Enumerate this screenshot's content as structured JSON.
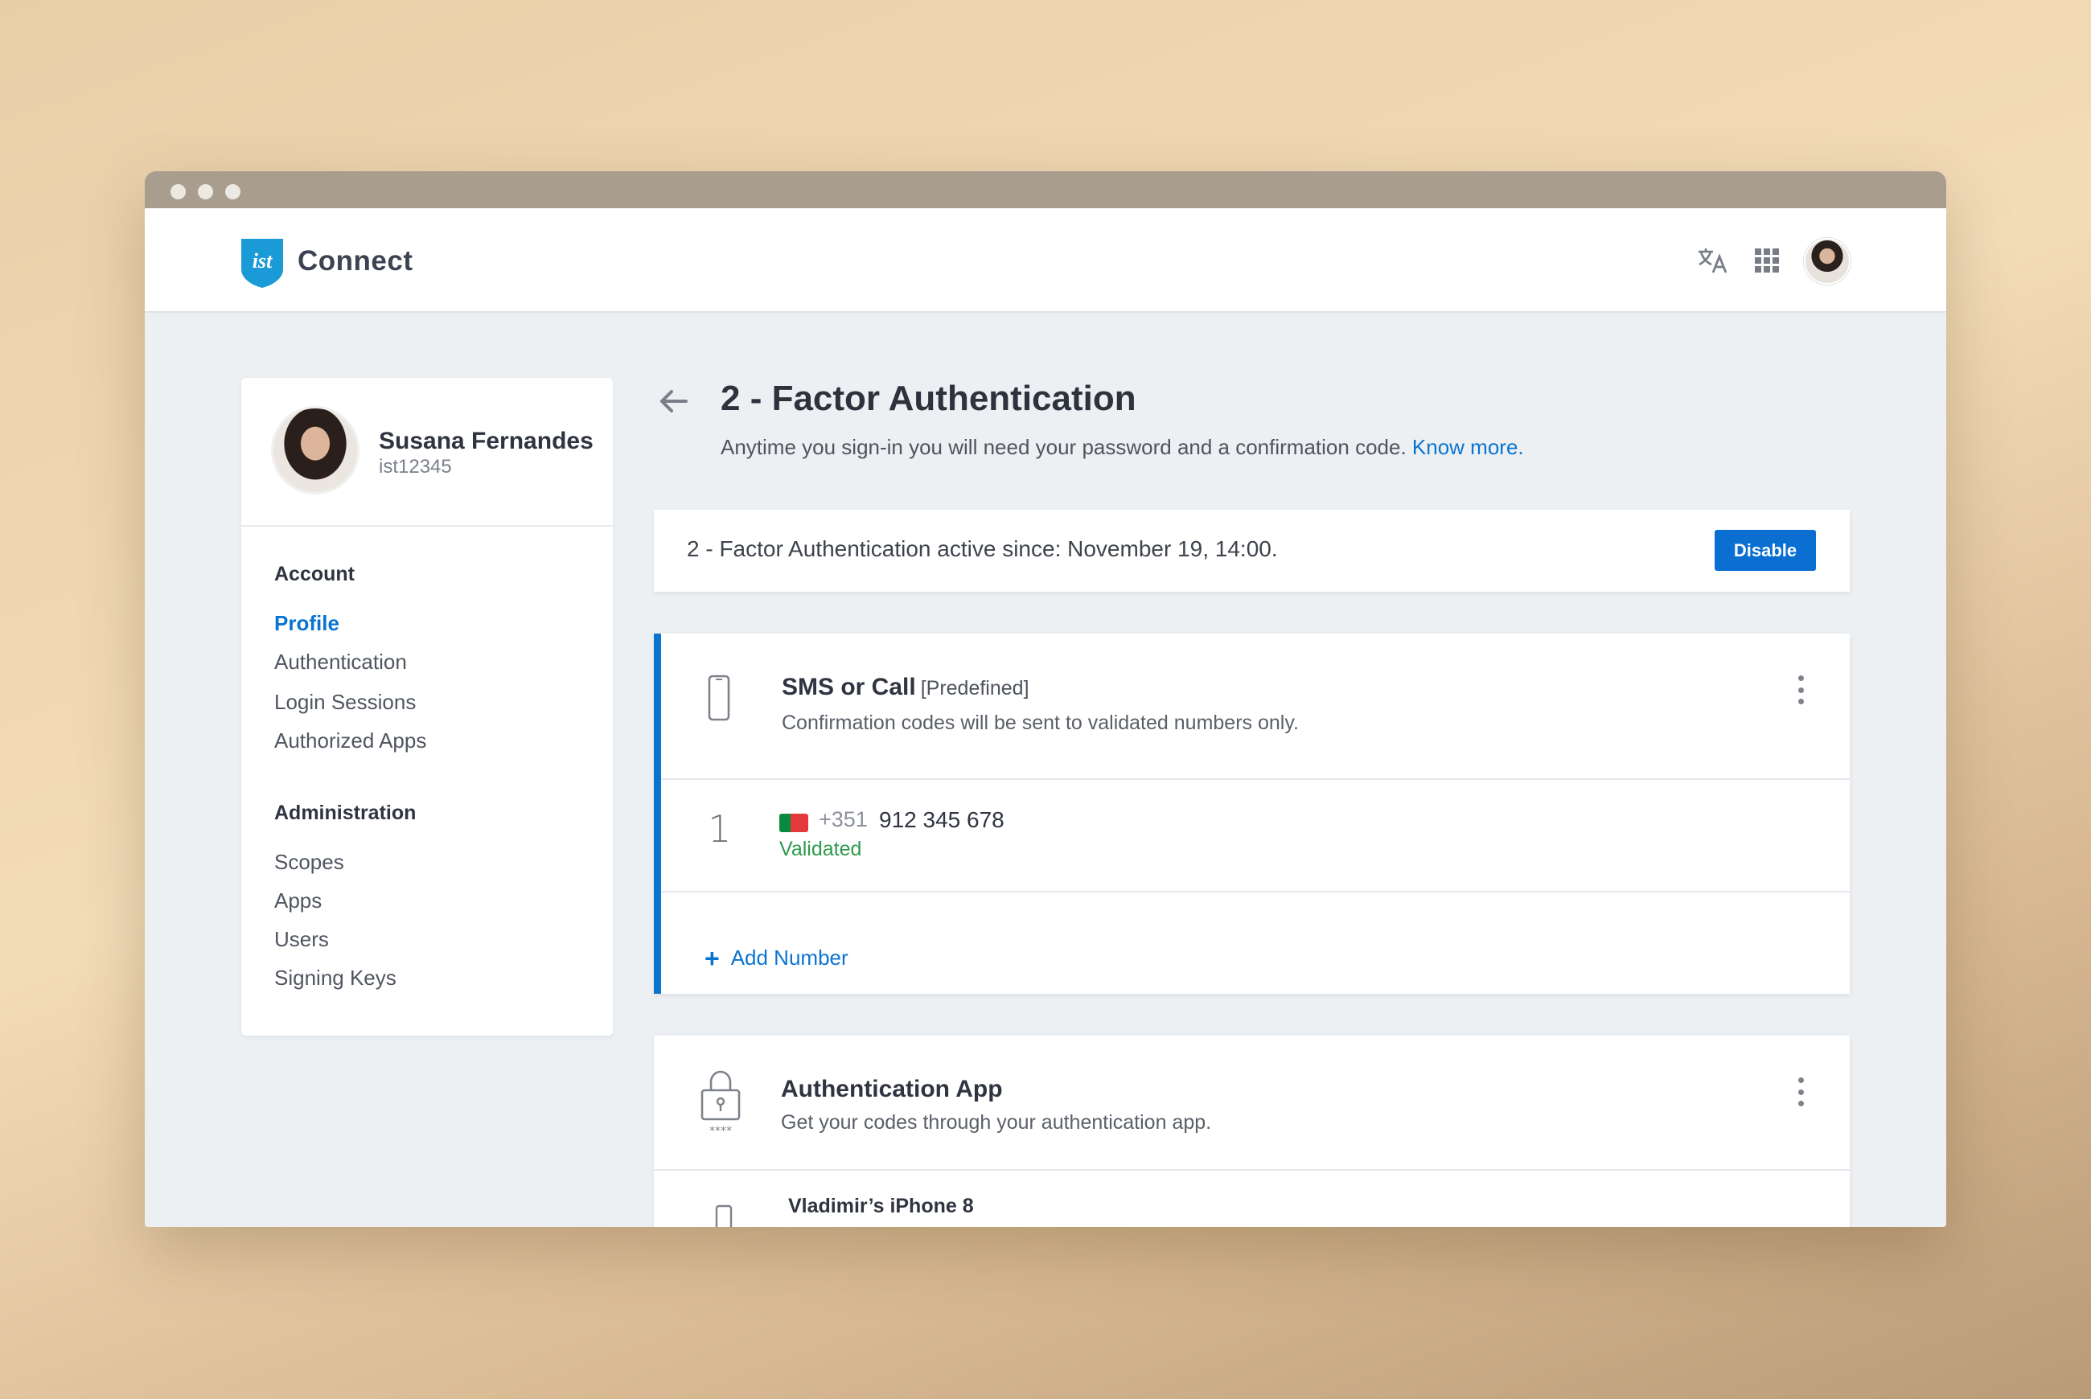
{
  "app": {
    "brand": "Connect",
    "logo_text": "ist"
  },
  "user": {
    "name": "Susana Fernandes",
    "username": "ist12345"
  },
  "sidebar": {
    "sections": [
      {
        "title": "Account",
        "items": [
          {
            "label": "Profile",
            "active": true
          },
          {
            "label": "Authentication"
          },
          {
            "label": "Login Sessions"
          },
          {
            "label": "Authorized Apps"
          }
        ]
      },
      {
        "title": "Administration",
        "items": [
          {
            "label": "Scopes"
          },
          {
            "label": "Apps"
          },
          {
            "label": "Users"
          },
          {
            "label": "Signing Keys"
          }
        ]
      }
    ]
  },
  "page": {
    "title": "2 - Factor Authentication",
    "subtitle": "Anytime you sign-in you will need your password and a confirmation code.",
    "know_more": "Know more."
  },
  "status": {
    "text": "2 - Factor Authentication active since: November 19, 14:00.",
    "disable_label": "Disable"
  },
  "sms": {
    "title": "SMS or Call",
    "tag": "[Predefined]",
    "description": "Confirmation codes will be sent to validated numbers only.",
    "numbers": [
      {
        "index": "1",
        "country_code": "+351",
        "number": "912 345 678",
        "status": "Validated"
      }
    ],
    "add_label": "Add Number"
  },
  "auth_app": {
    "title": "Authentication App",
    "description": "Get your codes through your authentication app.",
    "icon_caption": "****",
    "devices": [
      {
        "name": "Vladimir’s iPhone 8"
      }
    ]
  },
  "colors": {
    "accent": "#0a74d1",
    "success": "#2f9a4d",
    "logo": "#1a9ad6"
  },
  "icons": [
    "translate-icon",
    "apps-grid-icon",
    "back-arrow-icon",
    "phone-icon",
    "lock-icon",
    "more-vert-icon",
    "plus-icon"
  ]
}
